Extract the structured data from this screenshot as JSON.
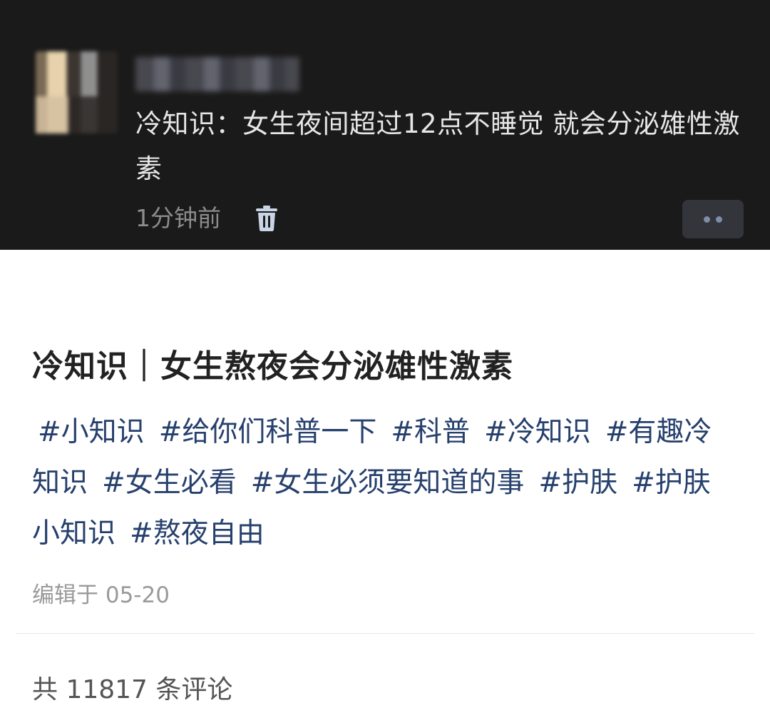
{
  "comment": {
    "text": "冷知识：女生夜间超过12点不睡觉 就会分泌雄性激素",
    "time": "1分钟前",
    "delete_icon": "trash-icon",
    "more_icon": "more-dots-icon"
  },
  "post": {
    "title": "冷知识｜女生熬夜会分泌雄性激素",
    "tags": [
      "#小知识",
      "#给你们科普一下",
      "#科普",
      "#冷知识",
      "#有趣冷知识",
      "#女生必看",
      "#女生必须要知道的事",
      "#护肤",
      "#护肤小知识",
      "#熬夜自由"
    ],
    "edit_time": "编辑于 05-20"
  },
  "comments_section": {
    "count_label": "共 11817 条评论"
  },
  "colors": {
    "dark_bg": "#1a1a1a",
    "tag_color": "#26406d",
    "more_dots": "#7d8da8"
  }
}
